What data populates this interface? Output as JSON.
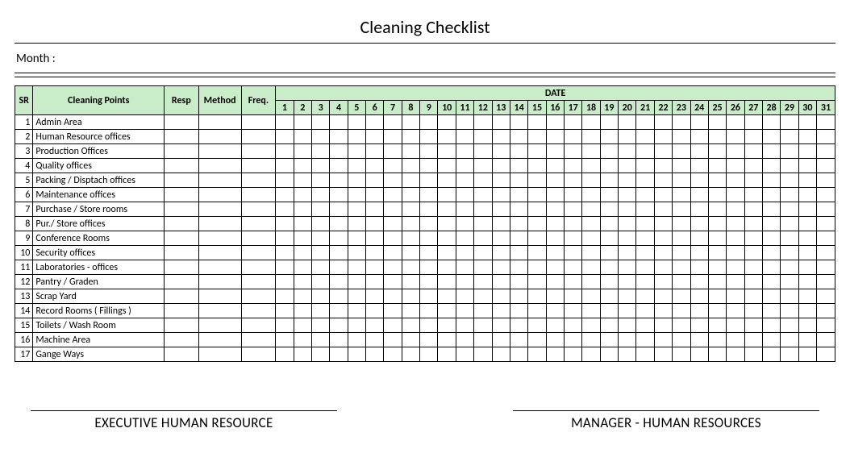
{
  "title": "Cleaning Checklist",
  "month_label": "Month :",
  "headers": {
    "sr": "SR",
    "points": "Cleaning Points",
    "resp": "Resp",
    "method": "Method",
    "freq": "Freq.",
    "date": "DATE"
  },
  "days": [
    "1",
    "2",
    "3",
    "4",
    "5",
    "6",
    "7",
    "8",
    "9",
    "10",
    "11",
    "12",
    "13",
    "14",
    "15",
    "16",
    "17",
    "18",
    "19",
    "20",
    "21",
    "22",
    "23",
    "24",
    "25",
    "26",
    "27",
    "28",
    "29",
    "30",
    "31"
  ],
  "rows": [
    {
      "sr": "1",
      "point": "Admin Area"
    },
    {
      "sr": "2",
      "point": "Human Resource offices"
    },
    {
      "sr": "3",
      "point": "Production Offices"
    },
    {
      "sr": "4",
      "point": "Quality offices"
    },
    {
      "sr": "5",
      "point": "Packing / Disptach offices"
    },
    {
      "sr": "6",
      "point": "Maintenance offices"
    },
    {
      "sr": "7",
      "point": "Purchase / Store rooms"
    },
    {
      "sr": "8",
      "point": "Pur./ Store offices"
    },
    {
      "sr": "9",
      "point": "Conference Rooms"
    },
    {
      "sr": "10",
      "point": "Security offices"
    },
    {
      "sr": "11",
      "point": "Laboratories - offices"
    },
    {
      "sr": "12",
      "point": "Pantry / Graden"
    },
    {
      "sr": "13",
      "point": "Scrap Yard"
    },
    {
      "sr": "14",
      "point": "Record Rooms ( Fillings )"
    },
    {
      "sr": "15",
      "point": "Toilets / Wash Room"
    },
    {
      "sr": "16",
      "point": "Machine Area"
    },
    {
      "sr": "17",
      "point": "Gange Ways"
    }
  ],
  "sign_left": "EXECUTIVE HUMAN RESOURCE",
  "sign_right": "MANAGER - HUMAN RESOURCES"
}
